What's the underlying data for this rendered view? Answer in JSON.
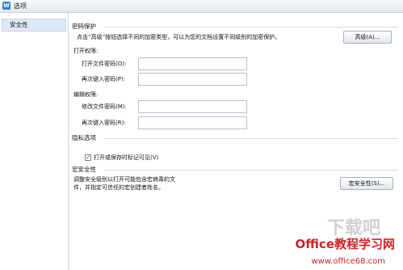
{
  "window": {
    "title": "选项",
    "app_icon_letter": "W"
  },
  "sidebar": {
    "items": [
      {
        "label": "安全性",
        "selected": true
      }
    ]
  },
  "password_protection": {
    "title": "密码保护",
    "description": "点击“高级”按钮选择不同的加密类型，可以为您的文档设置不同级别的加密保护。",
    "advanced_button": "高级(A)...",
    "open_permission": {
      "title": "打开权限:",
      "password_label": "打开文件密码(O):",
      "password_value": "",
      "confirm_label": "再次键入密码(P):",
      "confirm_value": ""
    },
    "edit_permission": {
      "title": "编辑权限:",
      "password_label": "修改文件密码(M):",
      "password_value": "",
      "confirm_label": "再次键入密码(R):",
      "confirm_value": ""
    }
  },
  "privacy": {
    "title": "隐私选项",
    "checkbox_label": "打开或保存时标记可见(V)",
    "checkbox_checked": true,
    "check_mark": "✓"
  },
  "macro_security": {
    "title": "宏安全性",
    "description_line1": "调整安全级别以打开可能包含宏病毒的文",
    "description_line2": "件，并指定可信任的宏创建者姓名。",
    "button": "宏安全性(S)..."
  },
  "watermark": {
    "top": "下载吧",
    "brand": "Office教程学习网",
    "url": "www.office68.com"
  },
  "colors": {
    "watermark_red": "#c9252b",
    "selected_bg": "#dfe9f6",
    "app_icon_blue": "#3a7bd5"
  }
}
